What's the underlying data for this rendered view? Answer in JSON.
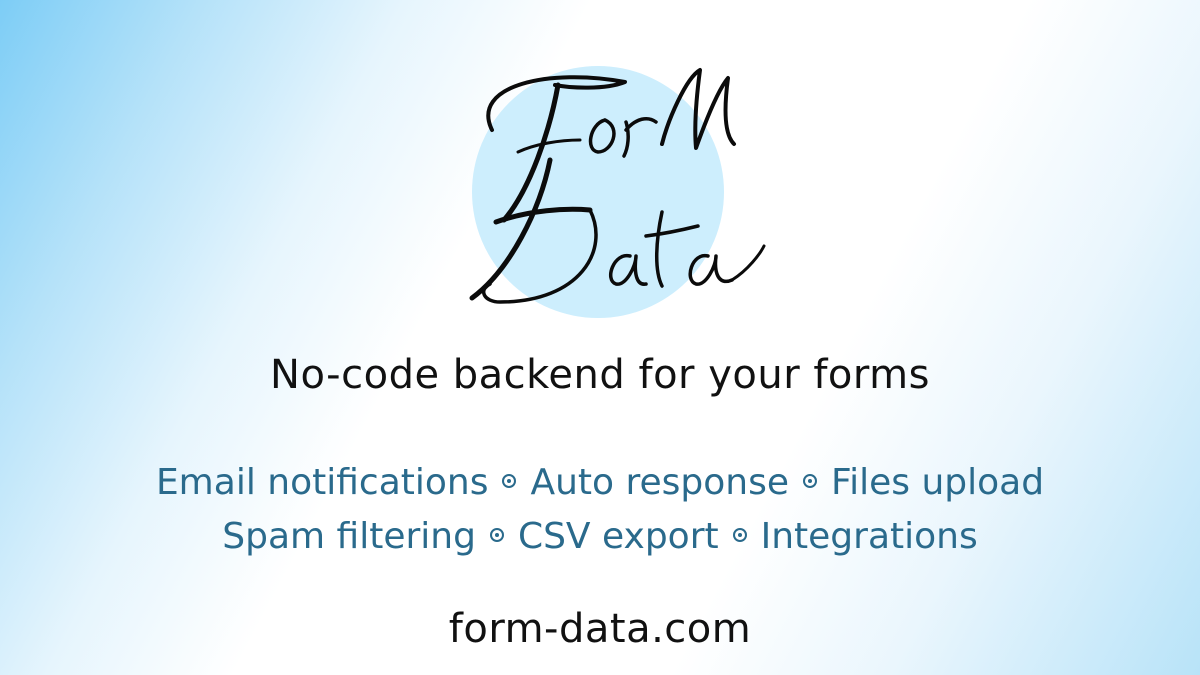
{
  "logo": {
    "text_line1": "Form",
    "text_line2": "Data",
    "icon": "form-data-script-logo",
    "circle_color": "#cdeefd",
    "ink_color": "#0b0b0b"
  },
  "tagline": "No-code backend for your forms",
  "features": {
    "separator_icon": "bullet-circle-icon",
    "color": "#2a6a8c",
    "line1": [
      "Email notifications",
      "Auto response",
      "Files upload"
    ],
    "line2": [
      "Spam filtering",
      "CSV export",
      "Integrations"
    ]
  },
  "domain": "form-data.com"
}
